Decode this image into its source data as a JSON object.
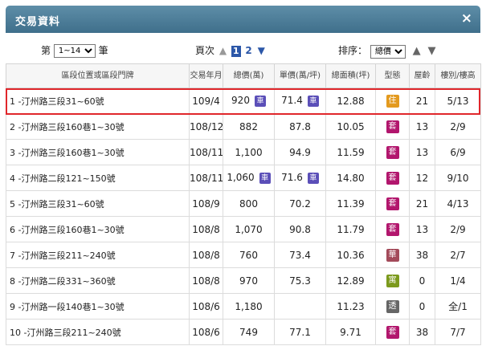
{
  "window": {
    "title": "交易資料",
    "close_glyph": "×"
  },
  "controls": {
    "range_prefix": "第",
    "range_value": "1~14",
    "range_suffix": "筆",
    "pages_label": "頁次",
    "current_page": "1",
    "next_page": "2",
    "sort_label": "排序：",
    "sort_value": "總價"
  },
  "columns": [
    "區段位置或區段門牌",
    "交易年月",
    "總價(萬)",
    "單價(萬/坪)",
    "總面積(坪)",
    "型態",
    "屋齡",
    "樓別/樓高"
  ],
  "rows": [
    {
      "location": "1 -汀州路三段31~60號",
      "date": "109/4",
      "total": "920",
      "total_tag": "車",
      "unit": "71.4",
      "unit_tag": "車",
      "area": "12.88",
      "type": "住",
      "type_color": "#e39a1f",
      "age": "21",
      "floor": "5/13"
    },
    {
      "location": "2 -汀州路三段160巷1~30號",
      "date": "108/12",
      "total": "882",
      "total_tag": "",
      "unit": "87.8",
      "unit_tag": "",
      "area": "10.05",
      "type": "套",
      "type_color": "#b2166d",
      "age": "13",
      "floor": "2/9"
    },
    {
      "location": "3 -汀州路三段160巷1~30號",
      "date": "108/11",
      "total": "1,100",
      "total_tag": "",
      "unit": "94.9",
      "unit_tag": "",
      "area": "11.59",
      "type": "套",
      "type_color": "#b2166d",
      "age": "13",
      "floor": "6/9"
    },
    {
      "location": "4 -汀州路二段121~150號",
      "date": "108/11",
      "total": "1,060",
      "total_tag": "車",
      "unit": "71.6",
      "unit_tag": "車",
      "area": "14.80",
      "type": "套",
      "type_color": "#b2166d",
      "age": "12",
      "floor": "9/10"
    },
    {
      "location": "5 -汀州路三段31~60號",
      "date": "108/9",
      "total": "800",
      "total_tag": "",
      "unit": "70.2",
      "unit_tag": "",
      "area": "11.39",
      "type": "套",
      "type_color": "#b2166d",
      "age": "21",
      "floor": "4/13"
    },
    {
      "location": "6 -汀州路三段160巷1~30號",
      "date": "108/8",
      "total": "1,070",
      "total_tag": "",
      "unit": "90.8",
      "unit_tag": "",
      "area": "11.79",
      "type": "套",
      "type_color": "#b2166d",
      "age": "13",
      "floor": "2/9"
    },
    {
      "location": "7 -汀州路三段211~240號",
      "date": "108/8",
      "total": "760",
      "total_tag": "",
      "unit": "73.4",
      "unit_tag": "",
      "area": "10.36",
      "type": "華",
      "type_color": "#a34a5a",
      "age": "38",
      "floor": "2/7"
    },
    {
      "location": "8 -汀州路二段331~360號",
      "date": "108/8",
      "total": "970",
      "total_tag": "",
      "unit": "75.3",
      "unit_tag": "",
      "area": "12.89",
      "type": "寓",
      "type_color": "#7c9a1d",
      "age": "0",
      "floor": "1/4"
    },
    {
      "location": "9 -汀州路一段140巷1~30號",
      "date": "108/6",
      "total": "1,180",
      "total_tag": "",
      "unit": "",
      "unit_tag": "",
      "area": "11.23",
      "type": "透",
      "type_color": "#666666",
      "age": "0",
      "floor": "全/1"
    },
    {
      "location": "10 -汀州路三段211~240號",
      "date": "108/6",
      "total": "749",
      "total_tag": "",
      "unit": "77.1",
      "unit_tag": "",
      "area": "9.71",
      "type": "套",
      "type_color": "#b2166d",
      "age": "38",
      "floor": "7/7"
    }
  ],
  "colors": {
    "title_bar": "#4b7c98",
    "highlight": "#e0262b",
    "price_tag": "#5b4fb8"
  }
}
